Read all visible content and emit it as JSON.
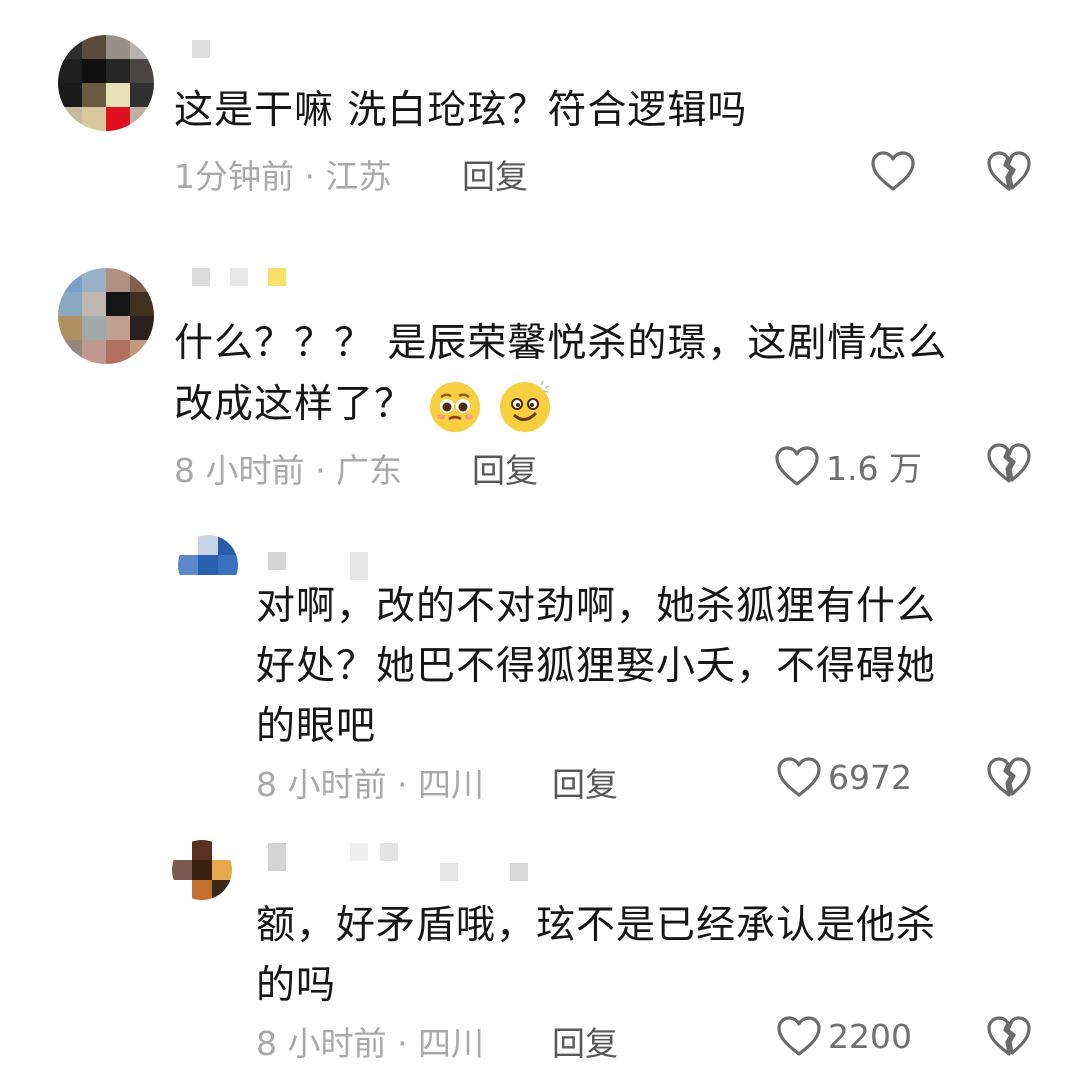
{
  "comments": [
    {
      "text": "这是干嘛 洗白玱玹？符合逻辑吗",
      "meta": "1分钟前 · 江苏",
      "reply": "回复",
      "likes": ""
    },
    {
      "text_line1": "什么？？？ 是辰荣馨悦杀的璟，这剧情怎么",
      "text_line2": "改成这样了？",
      "meta": "8 小时前 · 广东",
      "reply": "回复",
      "likes": "1.6 万",
      "emojis": [
        "pleading-face-emoji",
        "woozy-face-emoji"
      ]
    },
    {
      "text_line1": "对啊，改的不对劲啊，她杀狐狸有什么",
      "text_line2": "好处？她巴不得狐狸娶小夭，不得碍她",
      "text_line3": "的眼吧",
      "meta": "8 小时前 · 四川",
      "reply": "回复",
      "likes": "6972"
    },
    {
      "text_line1": "额，好矛盾哦，玹不是已经承认是他杀",
      "text_line2": "的吗",
      "meta": "8 小时前 · 四川",
      "reply": "回复",
      "likes": "2200"
    }
  ],
  "icons": {
    "like": "heart-outline-icon",
    "dislike": "broken-heart-icon"
  },
  "colors": {
    "text": "#161616",
    "meta": "#a9a9a9",
    "reply": "#585858",
    "icon": "#6b6b6b"
  }
}
